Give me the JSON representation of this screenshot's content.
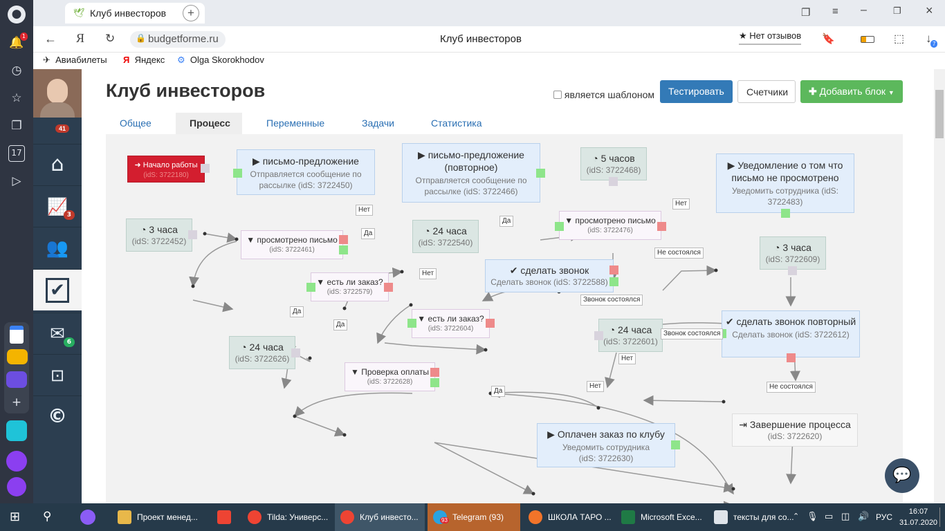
{
  "browser": {
    "tab_title": "Клуб инвесторов",
    "url": "budgetforme.ru",
    "page_title": "Клуб инвесторов",
    "reviews": "Нет отзывов",
    "downloads_badge": "7",
    "alerts_badge": "1"
  },
  "bookmarks": [
    "Авиабилеты",
    "Яндекс",
    "Olga Skorokhodov"
  ],
  "crm_sidebar": {
    "notif_count": "41",
    "items": [
      {
        "icon": "home-icon",
        "count": ""
      },
      {
        "icon": "chart-icon",
        "count": "3"
      },
      {
        "icon": "users-icon",
        "count": ""
      },
      {
        "icon": "check-icon",
        "count": ""
      },
      {
        "icon": "mail-icon",
        "count": "6"
      },
      {
        "icon": "safe-icon",
        "count": ""
      },
      {
        "icon": "c-logo-icon",
        "count": ""
      }
    ]
  },
  "page": {
    "title": "Клуб инвесторов",
    "template_label": "является шаблоном",
    "test_button": "Тестировать",
    "counters_button": "Счетчики",
    "add_block_button": "Добавить блок"
  },
  "tabs": [
    "Общее",
    "Процесс",
    "Переменные",
    "Задачи",
    "Статистика"
  ],
  "nodes": {
    "start": {
      "title": "Начало работы",
      "id": "(idS: 3722180)"
    },
    "n1": {
      "title": "письмо-предложение",
      "sub": "Отправляется сообщение по рассылке (idS: 3722450)"
    },
    "n2": {
      "title": "письмо-предложение (повторное)",
      "sub": "Отправляется сообщение по рассылке (idS: 3722466)"
    },
    "n3": {
      "title": "5 часов",
      "sub": "(idS: 3722468)"
    },
    "n4": {
      "title": "Уведомление о том что письмо не просмотрено",
      "sub": "Уведомить сотрудника (idS: 3722483)"
    },
    "n5": {
      "title": "3 часа",
      "sub": "(idS: 3722452)"
    },
    "n6": {
      "title": "просмотрено письмо",
      "sub": "(idS: 3722461)"
    },
    "n7": {
      "title": "24 часа",
      "sub": "(idS: 3722540)"
    },
    "n8": {
      "title": "просмотрено письмо",
      "sub": "(idS: 3722476)"
    },
    "n9": {
      "title": "3 часа",
      "sub": "(idS: 3722609)"
    },
    "n10": {
      "title": "есть ли заказ?",
      "sub": "(idS: 3722579)"
    },
    "n11": {
      "title": "сделать звонок",
      "sub": "Сделать звонок (idS: 3722588)"
    },
    "n12": {
      "title": "есть ли заказ?",
      "sub": "(idS: 3722604)"
    },
    "n13": {
      "title": "24 часа",
      "sub": "(idS: 3722601)"
    },
    "n14": {
      "title": "сделать звонок повторный",
      "sub": "Сделать звонок (idS: 3722612)"
    },
    "n15": {
      "title": "24 часа",
      "sub": "(idS: 3722626)"
    },
    "n16": {
      "title": "Проверка оплаты",
      "sub": "(idS: 3722628)"
    },
    "n17": {
      "title": "Завершение процесса",
      "sub": "(idS: 3722620)"
    },
    "n18": {
      "title": "Оплачен заказ по клубу",
      "sub": "Уведомить сотрудника (idS: 3722630)"
    }
  },
  "edge_labels": {
    "net": "Нет",
    "da": "Да",
    "ne_sost": "Не состоялся",
    "zvonok_sost": "Звонок состоялся"
  },
  "taskbar": {
    "items": [
      "Проект менед...",
      "",
      "Tilda: Универс...",
      "Клуб инвесто...",
      "Telegram (93)",
      "ШКОЛА ТАРО ...",
      "Microsoft Exce...",
      "тексты для со..."
    ],
    "telegram_badge": "93",
    "lang": "РУС",
    "time": "16:07",
    "date": "31.07.2020"
  }
}
